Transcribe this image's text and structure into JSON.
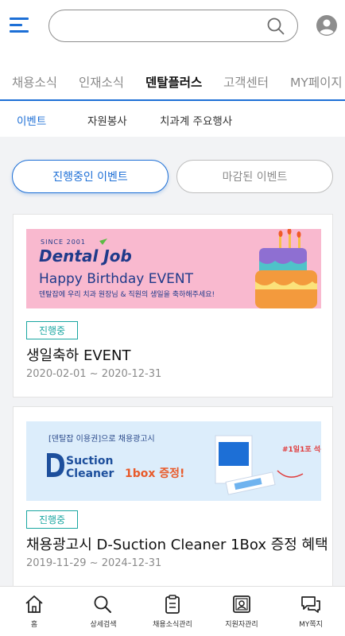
{
  "header": {
    "search_placeholder": ""
  },
  "main_tabs": [
    {
      "label": "채용소식",
      "active": false
    },
    {
      "label": "인재소식",
      "active": false
    },
    {
      "label": "덴탈플러스",
      "active": true
    },
    {
      "label": "고객센터",
      "active": false
    },
    {
      "label": "MY페이지",
      "active": false
    }
  ],
  "sub_tabs": [
    {
      "label": "이벤트",
      "active": true
    },
    {
      "label": "자원봉사",
      "active": false
    },
    {
      "label": "치과계 주요행사",
      "active": false
    }
  ],
  "filters": {
    "ongoing": "진행중인 이벤트",
    "closed": "마감된 이벤트"
  },
  "events": [
    {
      "banner": {
        "since": "SINCE 2001",
        "logo": "Dental Job",
        "headline": "Happy Birthday EVENT",
        "subline": "덴탈잡에 우리 치과 원장님 & 직원의 생일을 축하해주세요!"
      },
      "status": "진행중",
      "title": "생일축하 EVENT",
      "date": "2020-02-01 ~ 2020-12-31"
    },
    {
      "banner": {
        "top": "[덴탈잡 이용권]으로 채용광고시",
        "brand_line1": "Suction",
        "brand_line2": "Cleaner",
        "promo": "1box 증정!",
        "tag": "#1일1포 석션클리너"
      },
      "status": "진행중",
      "title": "채용광고시 D-Suction Cleaner 1Box 증정 혜택",
      "date": "2019-11-29 ~ 2024-12-31"
    }
  ],
  "bottom_nav": [
    {
      "label": "홈",
      "icon": "home-icon"
    },
    {
      "label": "상세검색",
      "icon": "search-icon"
    },
    {
      "label": "채용소식관리",
      "icon": "clipboard-icon"
    },
    {
      "label": "지원자관리",
      "icon": "applicant-icon"
    },
    {
      "label": "MY쪽지",
      "icon": "message-icon"
    }
  ],
  "colors": {
    "accent": "#1d6fd6",
    "status_teal": "#19a6a1",
    "banner1_bg": "#f9b9cf",
    "banner2_bg": "#dcedfb"
  }
}
